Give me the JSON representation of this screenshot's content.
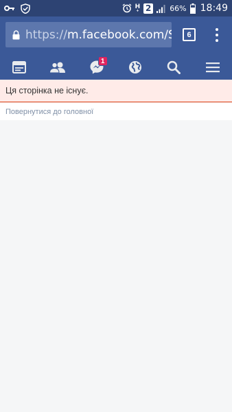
{
  "status_bar": {
    "network": "H",
    "network_sub": "+",
    "sim": "2",
    "battery_percent": "66%",
    "time": "18:49"
  },
  "browser": {
    "url_scheme": "https://",
    "url_host": "m.facebook.com/St",
    "tab_count": "6"
  },
  "nav": {
    "messages_badge": "1",
    "icons": [
      "newsfeed-icon",
      "friends-icon",
      "messenger-icon",
      "globe-icon",
      "search-icon",
      "menu-icon"
    ]
  },
  "page": {
    "error_message": "Ця сторінка не існує.",
    "back_link": "Повернутися до головної"
  },
  "colors": {
    "brand_blue": "#3b5998",
    "status_bar": "#2d4373",
    "error_bg": "#ffebe8",
    "error_border": "#dd3c10",
    "badge_red": "#e0245e"
  }
}
